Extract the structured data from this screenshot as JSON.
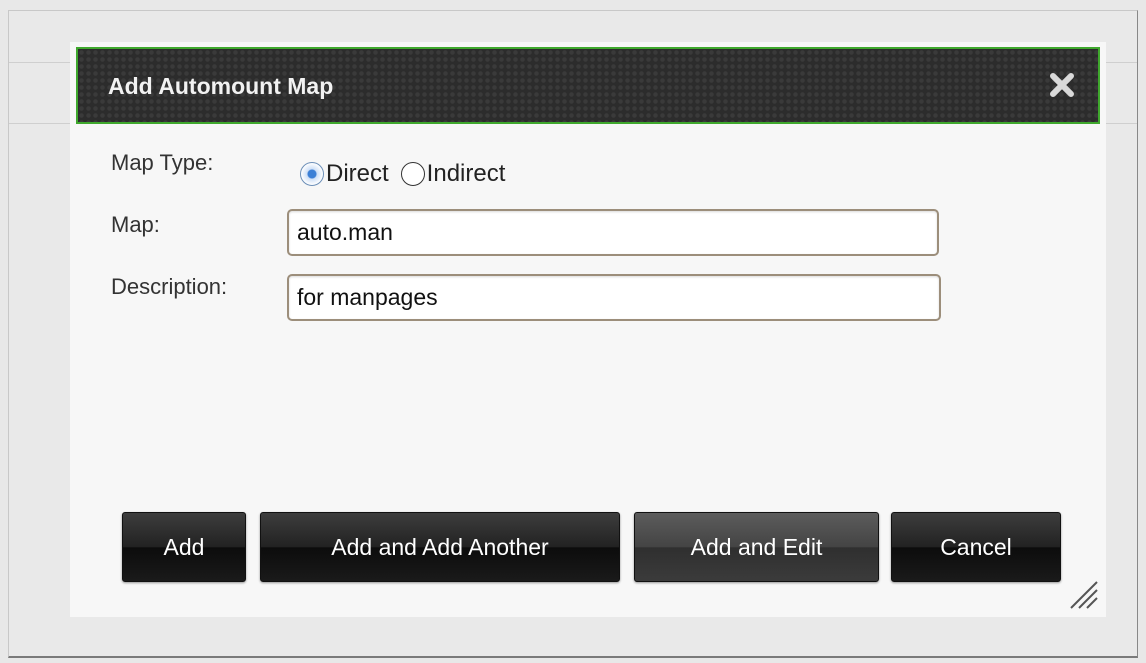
{
  "dialog": {
    "title": "Add Automount Map",
    "close_icon": "close-icon"
  },
  "form": {
    "map_type_label": "Map Type:",
    "map_type_options": [
      "Direct",
      "Indirect"
    ],
    "map_type_selected": "Direct",
    "map_label": "Map:",
    "map_value": "auto.man",
    "description_label": "Description:",
    "description_value": "for manpages"
  },
  "buttons": {
    "add": "Add",
    "add_another": "Add and Add Another",
    "add_edit": "Add and Edit",
    "cancel": "Cancel"
  },
  "colors": {
    "title_border": "#3fa82d",
    "title_bg": "#2c2c2c",
    "button_bg": "#1a1a1a"
  }
}
